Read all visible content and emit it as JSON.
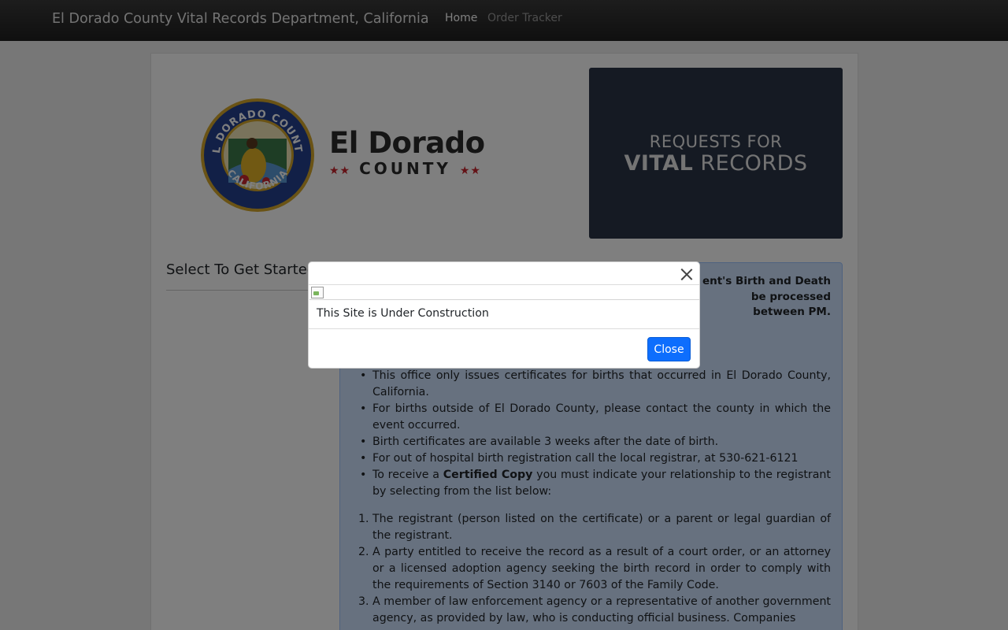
{
  "navbar": {
    "brand": "El Dorado County Vital Records Department, California",
    "links": [
      {
        "label": "Home",
        "active": true
      },
      {
        "label": "Order Tracker",
        "active": false
      }
    ]
  },
  "logo": {
    "seal_top_text": "EL DORADO COUNTY",
    "seal_bottom_text": "CALIFORNIA",
    "title": "El Dorado",
    "subtitle": "COUNTY",
    "stars": "★★",
    "accent_color": "#c8262f"
  },
  "banner": {
    "line1": "REQUESTS FOR",
    "line2_bold": "VITAL",
    "line2_rest": " RECORDS",
    "bg_color": "#2b3446"
  },
  "left": {
    "title": "Select To Get Started"
  },
  "info": {
    "top_text": "ent's Birth and Death be processed between PM.",
    "bullets": [
      "This office only issues certificates for births that occurred in El Dorado County, California.",
      "For births outside of El Dorado County, please contact the county in which the event occurred.",
      "Birth certificates are available 3 weeks after the date of birth.",
      "For out of hospital birth registration call the local registrar, at 530-621-6121"
    ],
    "certified_prefix": "To receive a ",
    "certified_bold": "Certified Copy",
    "certified_suffix": " you must indicate your relationship to the registrant by selecting from the list below:",
    "numbered": [
      {
        "num": "1.",
        "text": "The registrant (person listed on the certificate) or a parent or legal guardian of the registrant."
      },
      {
        "num": "2.",
        "text": "A party entitled to receive the record as a result of a court order, or an attorney or a licensed adoption agency seeking the birth record in order to comply with the requirements of Section 3140 or 7603 of the Family Code."
      },
      {
        "num": "3.",
        "text": "A member of law enforcement agency or a representative of another government agency, as provided by law, who is conducting official business.  Companies"
      }
    ]
  },
  "modal": {
    "message": "This Site is Under Construction",
    "close_label": "Close",
    "close_icon": "close-icon",
    "button_color": "#0d6efd"
  }
}
